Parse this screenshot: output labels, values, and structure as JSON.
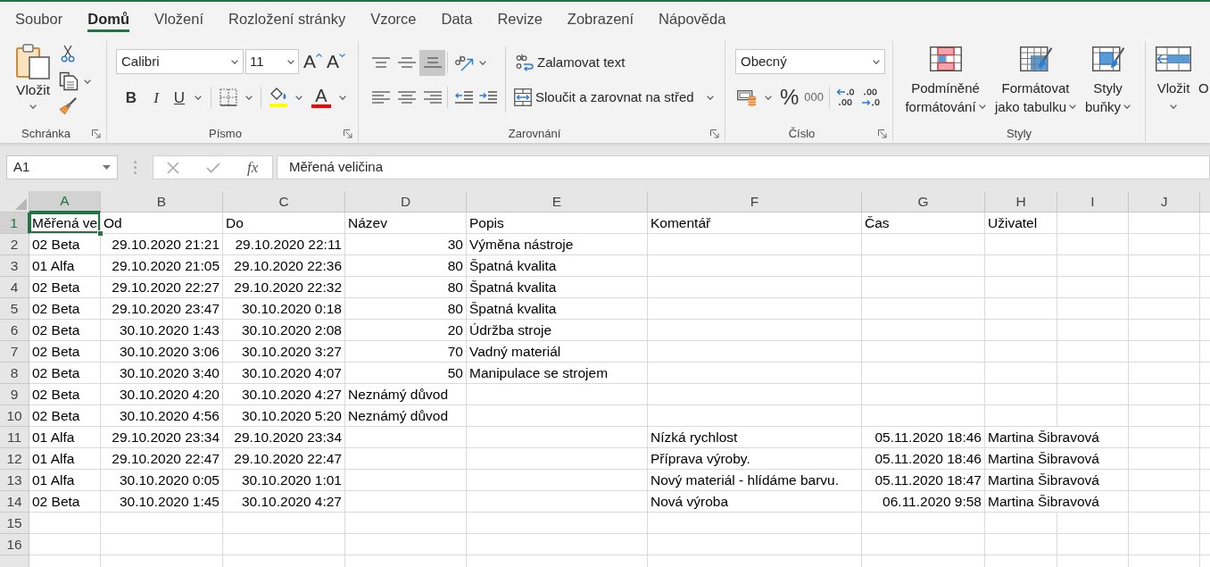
{
  "tabs": [
    {
      "label": "Soubor",
      "selected": false
    },
    {
      "label": "Domů",
      "selected": true
    },
    {
      "label": "Vložení",
      "selected": false
    },
    {
      "label": "Rozložení stránky",
      "selected": false
    },
    {
      "label": "Vzorce",
      "selected": false
    },
    {
      "label": "Data",
      "selected": false
    },
    {
      "label": "Revize",
      "selected": false
    },
    {
      "label": "Zobrazení",
      "selected": false
    },
    {
      "label": "Nápověda",
      "selected": false
    }
  ],
  "ribbon": {
    "clipboard": {
      "label": "Schránka",
      "paste": "Vložit"
    },
    "font": {
      "label": "Písmo",
      "font_name": "Calibri",
      "font_size": "11",
      "size_buttons": [
        {
          "kind": "grow",
          "glyph": "A"
        },
        {
          "kind": "shrink",
          "glyph": "A"
        }
      ],
      "style_buttons": [
        {
          "kind": "bold",
          "glyph": "B"
        },
        {
          "kind": "italic",
          "glyph": "I"
        },
        {
          "kind": "underline",
          "glyph": "U"
        }
      ],
      "fill_color": {
        "color": "#ffff00"
      },
      "font_color": {
        "glyph": "A",
        "color": "#ff0000"
      }
    },
    "alignment": {
      "label": "Zarovnání",
      "vertical": [
        {
          "kind": "top",
          "selected": false
        },
        {
          "kind": "middle",
          "selected": false
        },
        {
          "kind": "bottom",
          "selected": true
        }
      ],
      "horizontal": [
        {
          "kind": "left",
          "selected": false
        },
        {
          "kind": "center",
          "selected": false
        },
        {
          "kind": "right",
          "selected": false
        }
      ],
      "wrap_text": "Zalamovat text",
      "merge": "Sloučit a zarovnat na střed"
    },
    "number": {
      "label": "Číslo",
      "format": "Obecný",
      "buttons": [
        {
          "kind": "percent",
          "glyph": "%"
        },
        {
          "kind": "thousands",
          "glyph": "000"
        }
      ]
    },
    "styles": {
      "label": "Styly",
      "buttons": [
        {
          "kind": "conditional",
          "lines": [
            "Podmíněné",
            "formátování"
          ]
        },
        {
          "kind": "table",
          "lines": [
            "Formátovat",
            "jako tabulku"
          ]
        },
        {
          "kind": "cell",
          "lines": [
            "Styly",
            "buňky"
          ]
        }
      ]
    },
    "cells": {
      "buttons": [
        {
          "kind": "insert",
          "label": "Vložit"
        },
        {
          "kind": "clipped",
          "label": "O"
        }
      ]
    }
  },
  "formula_bar": {
    "name_box": "A1",
    "buttons": [
      {
        "kind": "cancel",
        "disabled": true
      },
      {
        "kind": "enter",
        "disabled": true
      }
    ],
    "function_glyph": "fx",
    "value": "Měřená veličina"
  },
  "sheet": {
    "columns": [
      {
        "label": "A",
        "selected": true
      },
      {
        "label": "B",
        "selected": false
      },
      {
        "label": "C",
        "selected": false
      },
      {
        "label": "D",
        "selected": false
      },
      {
        "label": "E",
        "selected": false
      },
      {
        "label": "F",
        "selected": false
      },
      {
        "label": "G",
        "selected": false
      },
      {
        "label": "H",
        "selected": false
      },
      {
        "label": "I",
        "selected": false
      },
      {
        "label": "J",
        "selected": false
      }
    ],
    "rows": [
      {
        "header": "1",
        "selected": true,
        "cells": [
          {
            "text": "Měřená ve",
            "kind": "text"
          },
          {
            "text": "Od",
            "kind": "text"
          },
          {
            "text": "Do",
            "kind": "text"
          },
          {
            "text": "Název",
            "kind": "text"
          },
          {
            "text": "Popis",
            "kind": "text"
          },
          {
            "text": "Komentář",
            "kind": "text"
          },
          {
            "text": "Čas",
            "kind": "text"
          },
          {
            "text": "Uživatel",
            "kind": "text"
          }
        ]
      },
      {
        "header": "2",
        "selected": false,
        "cells": [
          {
            "text": "02 Beta",
            "kind": "text"
          },
          {
            "text": "29.10.2020 21:21",
            "kind": "number"
          },
          {
            "text": "29.10.2020 22:11",
            "kind": "number"
          },
          {
            "text": "30",
            "kind": "number"
          },
          {
            "text": "Výměna nástroje",
            "kind": "text"
          }
        ]
      },
      {
        "header": "3",
        "selected": false,
        "cells": [
          {
            "text": "01 Alfa",
            "kind": "text"
          },
          {
            "text": "29.10.2020 21:05",
            "kind": "number"
          },
          {
            "text": "29.10.2020 22:36",
            "kind": "number"
          },
          {
            "text": "80",
            "kind": "number"
          },
          {
            "text": "Špatná kvalita",
            "kind": "text"
          }
        ]
      },
      {
        "header": "4",
        "selected": false,
        "cells": [
          {
            "text": "02 Beta",
            "kind": "text"
          },
          {
            "text": "29.10.2020 22:27",
            "kind": "number"
          },
          {
            "text": "29.10.2020 22:32",
            "kind": "number"
          },
          {
            "text": "80",
            "kind": "number"
          },
          {
            "text": "Špatná kvalita",
            "kind": "text"
          }
        ]
      },
      {
        "header": "5",
        "selected": false,
        "cells": [
          {
            "text": "02 Beta",
            "kind": "text"
          },
          {
            "text": "29.10.2020 23:47",
            "kind": "number"
          },
          {
            "text": "30.10.2020 0:18",
            "kind": "number"
          },
          {
            "text": "80",
            "kind": "number"
          },
          {
            "text": "Špatná kvalita",
            "kind": "text"
          }
        ]
      },
      {
        "header": "6",
        "selected": false,
        "cells": [
          {
            "text": "02 Beta",
            "kind": "text"
          },
          {
            "text": "30.10.2020 1:43",
            "kind": "number"
          },
          {
            "text": "30.10.2020 2:08",
            "kind": "number"
          },
          {
            "text": "20",
            "kind": "number"
          },
          {
            "text": "Údržba stroje",
            "kind": "text"
          }
        ]
      },
      {
        "header": "7",
        "selected": false,
        "cells": [
          {
            "text": "02 Beta",
            "kind": "text"
          },
          {
            "text": "30.10.2020 3:06",
            "kind": "number"
          },
          {
            "text": "30.10.2020 3:27",
            "kind": "number"
          },
          {
            "text": "70",
            "kind": "number"
          },
          {
            "text": "Vadný materiál",
            "kind": "text"
          }
        ]
      },
      {
        "header": "8",
        "selected": false,
        "cells": [
          {
            "text": "02 Beta",
            "kind": "text"
          },
          {
            "text": "30.10.2020 3:40",
            "kind": "number"
          },
          {
            "text": "30.10.2020 4:07",
            "kind": "number"
          },
          {
            "text": "50",
            "kind": "number"
          },
          {
            "text": "Manipulace se strojem",
            "kind": "text"
          }
        ]
      },
      {
        "header": "9",
        "selected": false,
        "cells": [
          {
            "text": "02 Beta",
            "kind": "text"
          },
          {
            "text": "30.10.2020 4:20",
            "kind": "number"
          },
          {
            "text": "30.10.2020 4:27",
            "kind": "number"
          },
          {
            "text": "Neznámý důvod",
            "kind": "text"
          }
        ]
      },
      {
        "header": "10",
        "selected": false,
        "cells": [
          {
            "text": "02 Beta",
            "kind": "text"
          },
          {
            "text": "30.10.2020 4:56",
            "kind": "number"
          },
          {
            "text": "30.10.2020 5:20",
            "kind": "number"
          },
          {
            "text": "Neznámý důvod",
            "kind": "text"
          }
        ]
      },
      {
        "header": "11",
        "selected": false,
        "cells": [
          {
            "text": "01 Alfa",
            "kind": "text"
          },
          {
            "text": "29.10.2020 23:34",
            "kind": "number"
          },
          {
            "text": "29.10.2020 23:34",
            "kind": "number"
          },
          null,
          null,
          {
            "text": "Nízká rychlost",
            "kind": "text"
          },
          {
            "text": "05.11.2020 18:46",
            "kind": "number"
          },
          {
            "text": "Martina Šibravová",
            "kind": "text",
            "overflow": true
          }
        ]
      },
      {
        "header": "12",
        "selected": false,
        "cells": [
          {
            "text": "01 Alfa",
            "kind": "text"
          },
          {
            "text": "29.10.2020 22:47",
            "kind": "number"
          },
          {
            "text": "29.10.2020 22:47",
            "kind": "number"
          },
          null,
          null,
          {
            "text": "Příprava výroby.",
            "kind": "text"
          },
          {
            "text": "05.11.2020 18:46",
            "kind": "number"
          },
          {
            "text": "Martina Šibravová",
            "kind": "text",
            "overflow": true
          }
        ]
      },
      {
        "header": "13",
        "selected": false,
        "cells": [
          {
            "text": "01 Alfa",
            "kind": "text"
          },
          {
            "text": "30.10.2020 0:05",
            "kind": "number"
          },
          {
            "text": "30.10.2020 1:01",
            "kind": "number"
          },
          null,
          null,
          {
            "text": "Nový materiál - hlídáme barvu.",
            "kind": "text"
          },
          {
            "text": "05.11.2020 18:47",
            "kind": "number"
          },
          {
            "text": "Martina Šibravová",
            "kind": "text",
            "overflow": true
          }
        ]
      },
      {
        "header": "14",
        "selected": false,
        "cells": [
          {
            "text": "02 Beta",
            "kind": "text"
          },
          {
            "text": "30.10.2020 1:45",
            "kind": "number"
          },
          {
            "text": "30.10.2020 4:27",
            "kind": "number"
          },
          null,
          null,
          {
            "text": "Nová výroba",
            "kind": "text"
          },
          {
            "text": "06.11.2020 9:58",
            "kind": "number"
          },
          {
            "text": "Martina Šibravová",
            "kind": "text",
            "overflow": true
          }
        ]
      },
      {
        "header": "15",
        "selected": false
      },
      {
        "header": "16",
        "selected": false
      },
      {
        "selected": false
      }
    ]
  }
}
